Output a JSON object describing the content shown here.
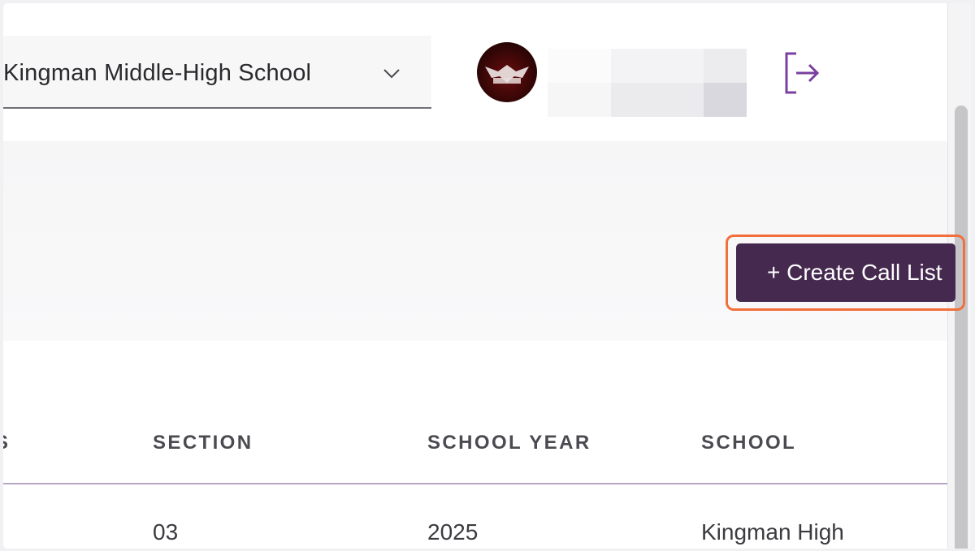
{
  "header": {
    "school_select": {
      "value": "Kingman Middle-High School",
      "icon": "chevron-down-icon"
    },
    "avatar": {
      "icon": "owl-logo"
    },
    "logout": {
      "icon": "logout-icon",
      "color": "#7b3fa0"
    }
  },
  "toolbar": {
    "create_label": "+ Create Call List",
    "accent": "#45294f",
    "highlight": "#f26f3b"
  },
  "table": {
    "columns": [
      "SECTION",
      "SCHOOL YEAR",
      "SCHOOL"
    ],
    "rows": [
      {
        "section": "03",
        "school_year": "2025",
        "school": "Kingman High"
      }
    ]
  }
}
